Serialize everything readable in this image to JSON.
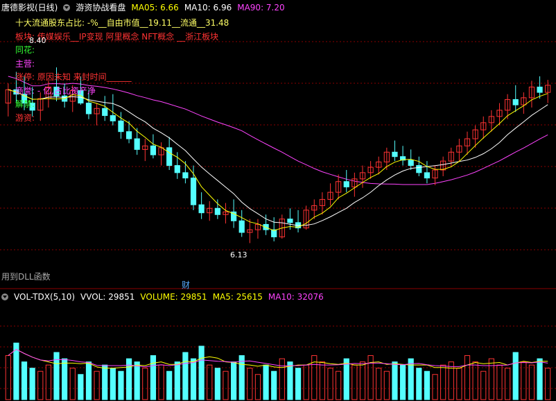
{
  "price_panel": {
    "title": "唐德影视(日线)",
    "indicator_name": "游资协战看盘",
    "ma_labels": [
      {
        "text": "MA05: 6.66",
        "color": "#ffff00"
      },
      {
        "text": "MA10: 6.96",
        "color": "#ffffff"
      },
      {
        "text": "MA90: 7.20",
        "color": "#ff44ff"
      }
    ],
    "info_lines": [
      {
        "text": "十大流通股东占比: -%__自由市值__19.11__流通__31.48",
        "color": "#ffff66"
      },
      {
        "text": "板块:    传媒娱乐__IP变现 阿里概念 NFT概念 __浙江板块",
        "color": "#ff3333"
      },
      {
        "text": "同花:",
        "color": "#33ff33"
      },
      {
        "text": "主营:",
        "color": "#ff44ff"
      },
      {
        "text": "涨停:    原因未知  来封时间______",
        "color": "#ff3333"
      },
      {
        "text": "商誉:    - 亿,占比资产净",
        "color": "#ff44ff"
      },
      {
        "text": "解禁:",
        "color": "#33ff33"
      },
      {
        "text": "游资:",
        "color": "#ff3333"
      }
    ],
    "high_marker": "8.40",
    "low_marker": "6.13",
    "dll_note": "用到DLL函数",
    "finance_marker": "财"
  },
  "volume_panel": {
    "indicator_name": "VOL-TDX(5,10)",
    "labels": [
      {
        "text": "VVOL: 29851",
        "color": "#ffffff"
      },
      {
        "text": "VOLUME: 29851",
        "color": "#ffff00"
      },
      {
        "text": "MA5: 25615",
        "color": "#ffff00"
      },
      {
        "text": "MA10: 32076",
        "color": "#ff44ff"
      }
    ]
  },
  "colors": {
    "up": "#ff3333",
    "down": "#54ffff",
    "ma5": "#ffff00",
    "ma10": "#ffffff",
    "ma90": "#ff44ff",
    "grid": "#8b0000"
  },
  "chart_data": {
    "type": "candlestick",
    "price_ylim": [
      5.9,
      8.7
    ],
    "ohlc": [
      [
        7.7,
        7.92,
        7.55,
        7.85
      ],
      [
        7.85,
        8.05,
        7.7,
        7.8
      ],
      [
        7.8,
        8.0,
        7.62,
        7.7
      ],
      [
        7.7,
        7.88,
        7.55,
        7.62
      ],
      [
        7.62,
        7.82,
        7.5,
        7.75
      ],
      [
        7.75,
        7.95,
        7.65,
        7.88
      ],
      [
        7.88,
        8.1,
        7.72,
        7.78
      ],
      [
        7.78,
        7.92,
        7.65,
        7.72
      ],
      [
        7.72,
        7.9,
        7.6,
        7.84
      ],
      [
        7.84,
        8.0,
        7.68,
        7.7
      ],
      [
        7.7,
        7.85,
        7.52,
        7.58
      ],
      [
        7.58,
        7.7,
        7.45,
        7.64
      ],
      [
        7.64,
        7.78,
        7.5,
        7.56
      ],
      [
        7.56,
        7.8,
        7.45,
        7.5
      ],
      [
        7.5,
        7.6,
        7.3,
        7.38
      ],
      [
        7.38,
        7.5,
        7.25,
        7.3
      ],
      [
        7.3,
        7.42,
        7.12,
        7.18
      ],
      [
        7.18,
        7.3,
        7.05,
        7.22
      ],
      [
        7.22,
        7.35,
        7.08,
        7.12
      ],
      [
        7.12,
        7.26,
        7.0,
        7.2
      ],
      [
        7.2,
        7.32,
        6.95,
        7.0
      ],
      [
        7.0,
        7.15,
        6.85,
        6.92
      ],
      [
        6.92,
        7.05,
        6.8,
        6.86
      ],
      [
        6.86,
        7.0,
        6.5,
        6.56
      ],
      [
        6.56,
        6.7,
        6.4,
        6.47
      ],
      [
        6.47,
        6.6,
        6.38,
        6.52
      ],
      [
        6.52,
        6.62,
        6.4,
        6.45
      ],
      [
        6.45,
        6.58,
        6.35,
        6.48
      ],
      [
        6.48,
        6.62,
        6.3,
        6.38
      ],
      [
        6.38,
        6.5,
        6.2,
        6.25
      ],
      [
        6.25,
        6.4,
        6.13,
        6.28
      ],
      [
        6.28,
        6.4,
        6.18,
        6.34
      ],
      [
        6.34,
        6.45,
        6.22,
        6.28
      ],
      [
        6.28,
        6.42,
        6.15,
        6.2
      ],
      [
        6.2,
        6.45,
        6.18,
        6.4
      ],
      [
        6.4,
        6.52,
        6.28,
        6.36
      ],
      [
        6.36,
        6.5,
        6.25,
        6.3
      ],
      [
        6.3,
        6.55,
        6.28,
        6.5
      ],
      [
        6.5,
        6.62,
        6.4,
        6.55
      ],
      [
        6.55,
        6.7,
        6.45,
        6.62
      ],
      [
        6.62,
        6.8,
        6.55,
        6.7
      ],
      [
        6.7,
        6.9,
        6.62,
        6.82
      ],
      [
        6.82,
        6.95,
        6.7,
        6.76
      ],
      [
        6.76,
        6.92,
        6.65,
        6.85
      ],
      [
        6.85,
        7.0,
        6.75,
        6.92
      ],
      [
        6.92,
        7.05,
        6.85,
        6.98
      ],
      [
        6.98,
        7.1,
        6.9,
        7.04
      ],
      [
        7.04,
        7.2,
        6.95,
        7.15
      ],
      [
        7.15,
        7.28,
        7.05,
        7.1
      ],
      [
        7.1,
        7.22,
        7.0,
        7.06
      ],
      [
        7.06,
        7.18,
        6.95,
        7.0
      ],
      [
        7.0,
        7.1,
        6.88,
        6.92
      ],
      [
        6.92,
        7.05,
        6.8,
        6.86
      ],
      [
        6.86,
        7.0,
        6.78,
        6.95
      ],
      [
        6.95,
        7.1,
        6.88,
        7.05
      ],
      [
        7.05,
        7.2,
        6.98,
        7.15
      ],
      [
        7.15,
        7.3,
        7.05,
        7.22
      ],
      [
        7.22,
        7.38,
        7.12,
        7.3
      ],
      [
        7.3,
        7.45,
        7.2,
        7.4
      ],
      [
        7.4,
        7.55,
        7.3,
        7.48
      ],
      [
        7.48,
        7.62,
        7.38,
        7.55
      ],
      [
        7.55,
        7.7,
        7.45,
        7.62
      ],
      [
        7.62,
        7.8,
        7.52,
        7.74
      ],
      [
        7.74,
        7.9,
        7.6,
        7.68
      ],
      [
        7.68,
        7.82,
        7.58,
        7.76
      ],
      [
        7.76,
        7.95,
        7.65,
        7.88
      ],
      [
        7.88,
        8.0,
        7.75,
        7.82
      ],
      [
        7.82,
        7.96,
        7.7,
        7.9
      ]
    ],
    "volume": [
      14,
      18,
      12,
      10,
      9,
      11,
      15,
      13,
      10,
      8,
      12,
      9,
      11,
      10,
      9,
      13,
      12,
      10,
      14,
      11,
      9,
      12,
      15,
      13,
      17,
      11,
      10,
      9,
      12,
      14,
      10,
      8,
      11,
      9,
      13,
      12,
      10,
      11,
      14,
      12,
      10,
      9,
      13,
      11,
      12,
      14,
      10,
      9,
      12,
      11,
      13,
      10,
      9,
      8,
      11,
      12,
      10,
      14,
      12,
      9,
      13,
      11,
      10,
      15,
      12,
      11,
      13,
      10
    ],
    "volume_ylim": [
      0,
      30
    ]
  }
}
